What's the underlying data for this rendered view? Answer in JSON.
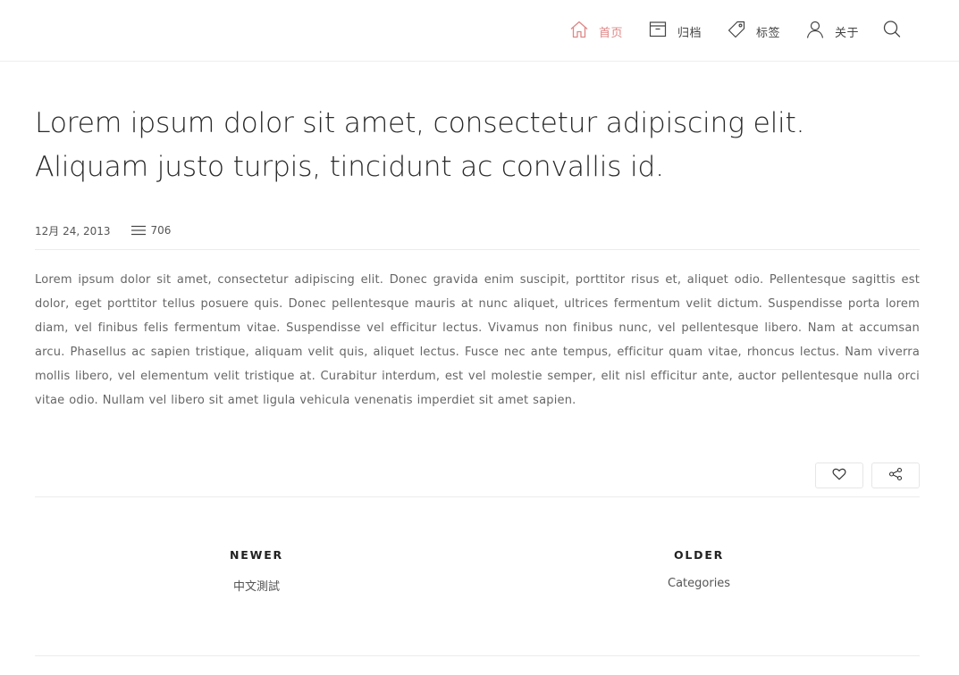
{
  "nav": {
    "items": [
      {
        "label": "首页",
        "icon": "home-icon",
        "active": true
      },
      {
        "label": "归档",
        "icon": "archive-icon",
        "active": false
      },
      {
        "label": "标签",
        "icon": "tag-icon",
        "active": false
      },
      {
        "label": "关于",
        "icon": "user-icon",
        "active": false
      }
    ],
    "search_icon": "search-icon",
    "active_color": "#e08585"
  },
  "post": {
    "title": "Lorem ipsum dolor sit amet, consectetur adipiscing elit. Aliquam justo turpis, tincidunt ac convallis id.",
    "date": "12月 24, 2013",
    "count": "706",
    "count_icon": "lines-icon",
    "body": "Lorem ipsum dolor sit amet, consectetur adipiscing elit. Donec gravida enim suscipit, porttitor risus et, aliquet odio. Pellentesque sagittis est dolor, eget porttitor tellus posuere quis. Donec pellentesque mauris at nunc aliquet, ultrices fermentum velit dictum. Suspendisse porta lorem diam, vel finibus felis fermentum vitae. Suspendisse vel efficitur lectus. Vivamus non finibus nunc, vel pellentesque libero. Nam at accumsan arcu. Phasellus ac sapien tristique, aliquam velit quis, aliquet lectus. Fusce nec ante tempus, efficitur quam vitae, rhoncus lectus. Nam viverra mollis libero, vel elementum velit tristique at. Curabitur interdum, est vel molestie semper, elit nisl efficitur ante, auctor pellentesque nulla orci vitae odio. Nullam vel libero sit amet ligula vehicula venenatis imperdiet sit amet sapien."
  },
  "actions": {
    "like_icon": "heart-icon",
    "share_icon": "share-icon"
  },
  "pager": {
    "newer_heading": "NEWER",
    "newer_link": "中文測試",
    "older_heading": "OLDER",
    "older_link": "Categories"
  }
}
